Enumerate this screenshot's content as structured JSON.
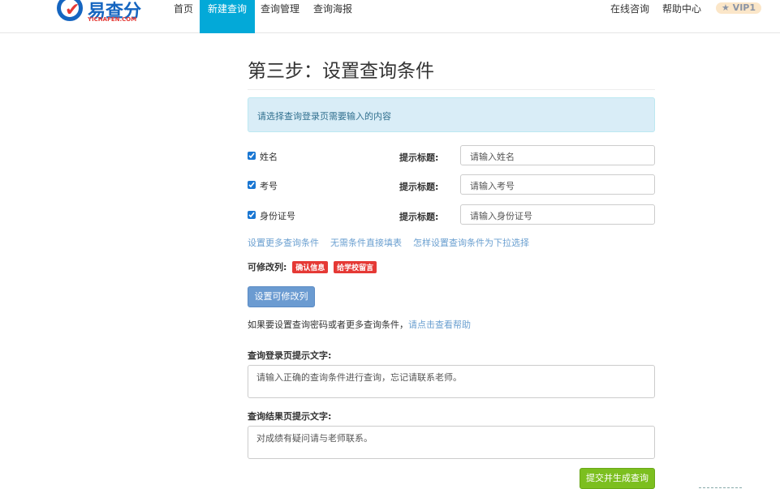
{
  "logo": {
    "brand": "易查分",
    "sub": "YICHAFEN.COM"
  },
  "nav": {
    "items": [
      "首页",
      "新建查询",
      "查询管理",
      "查询海报"
    ],
    "right": [
      "在线咨询",
      "帮助中心"
    ],
    "vip": "★ VIP1"
  },
  "page": {
    "title": "第三步：设置查询条件",
    "alert": "请选择查询登录页需要输入的内容"
  },
  "conditions": [
    {
      "label": "姓名",
      "checked": true,
      "tip": "提示标题:",
      "value": "请输入姓名"
    },
    {
      "label": "考号",
      "checked": true,
      "tip": "提示标题:",
      "value": "请输入考号"
    },
    {
      "label": "身份证号",
      "checked": true,
      "tip": "提示标题:",
      "value": "请输入身份证号"
    }
  ],
  "links": [
    "设置更多查询条件",
    "无需条件直接填表",
    "怎样设置查询条件为下拉选择"
  ],
  "editable": {
    "label": "可修改列:",
    "tags": [
      "确认信息",
      "给学校留言"
    ],
    "button": "设置可修改列"
  },
  "help": {
    "text": "如果要设置查询密码或者更多查询条件，",
    "link": "请点击查看帮助"
  },
  "login_tip": {
    "label": "查询登录页提示文字:",
    "value": "请输入正确的查询条件进行查询，忘记请联系老师。"
  },
  "result_tip": {
    "label": "查询结果页提示文字:",
    "value": "对成绩有疑问请与老师联系。"
  },
  "submit": "提交并生成查询"
}
